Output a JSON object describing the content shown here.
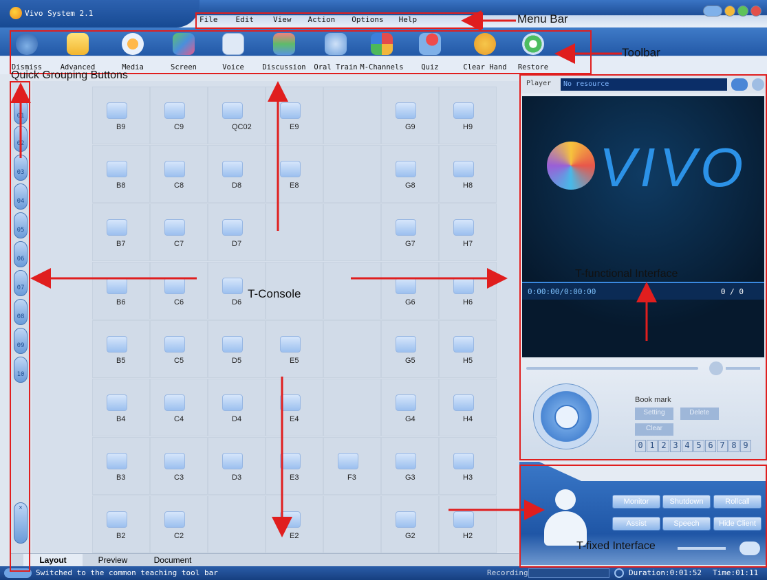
{
  "app": {
    "title": "Vivo System 2.1"
  },
  "menu": {
    "items": [
      "File",
      "Edit",
      "View",
      "Action",
      "Options",
      "Help"
    ]
  },
  "toolbar": {
    "items": [
      "Dismiss",
      "Advanced",
      "Media",
      "Screen",
      "Voice",
      "Discussion",
      "Oral Train",
      "M-Channels",
      "Quiz",
      "Clear Hand",
      "Restore"
    ]
  },
  "groups": [
    "01",
    "02",
    "03",
    "04",
    "05",
    "06",
    "07",
    "08",
    "09",
    "10"
  ],
  "seats": [
    [
      "B9",
      "C9",
      "QC02",
      "E9",
      "",
      "G9",
      "H9"
    ],
    [
      "B8",
      "C8",
      "D8",
      "E8",
      "",
      "G8",
      "H8"
    ],
    [
      "B7",
      "C7",
      "D7",
      "",
      "",
      "G7",
      "H7"
    ],
    [
      "B6",
      "C6",
      "D6",
      "",
      "",
      "G6",
      "H6"
    ],
    [
      "B5",
      "C5",
      "D5",
      "E5",
      "",
      "G5",
      "H5"
    ],
    [
      "B4",
      "C4",
      "D4",
      "E4",
      "",
      "G4",
      "H4"
    ],
    [
      "B3",
      "C3",
      "D3",
      "E3",
      "F3",
      "G3",
      "H3"
    ],
    [
      "B2",
      "C2",
      "",
      "E2",
      "",
      "G2",
      "H2"
    ]
  ],
  "tabs": [
    "Layout",
    "Preview",
    "Document"
  ],
  "status": {
    "message": "Switched to the common teaching tool bar",
    "recording": "Recording",
    "duration": "Duration:0:01:52",
    "time": "Time:01:11"
  },
  "player": {
    "label": "Player",
    "resource": "No resource",
    "time": "0:00:00/0:00:00",
    "pages": "0 / 0",
    "logo": "VIVO"
  },
  "bookmark": {
    "title": "Book mark",
    "buttons": [
      "Setting",
      "Delete",
      "Clear"
    ],
    "digits": [
      "0",
      "1",
      "2",
      "3",
      "4",
      "5",
      "6",
      "7",
      "8",
      "9"
    ]
  },
  "fixed": {
    "buttons": [
      "Monitor",
      "Shutdown",
      "Rollcall",
      "Assist",
      "Speech",
      "Hide Client"
    ]
  },
  "annotations": {
    "menu_bar": "Menu Bar",
    "toolbar": "Toolbar",
    "quick_grouping": "Quick Grouping Buttons",
    "t_console": "T-Console",
    "t_functional": "T-functional Interface",
    "t_fixed": "T-fixed Interface"
  },
  "colors": {
    "accent": "#2359a7",
    "annotation": "#e01e1e",
    "panel": "#d6dfeb"
  }
}
